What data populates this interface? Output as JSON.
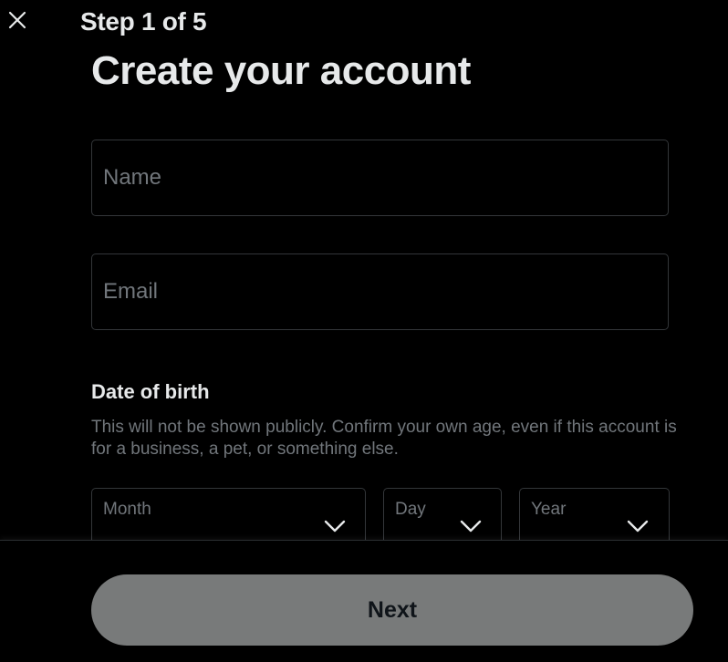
{
  "header": {
    "close_icon": "close-icon",
    "step_label": "Step 1 of 5"
  },
  "main": {
    "title": "Create your account",
    "name_field": {
      "placeholder": "Name",
      "value": ""
    },
    "email_field": {
      "placeholder": "Email",
      "value": ""
    },
    "dob": {
      "heading": "Date of birth",
      "description": "This will not be shown publicly. Confirm your own age, even if this account is for a business, a pet, or something else.",
      "month_label": "Month",
      "day_label": "Day",
      "year_label": "Year"
    }
  },
  "footer": {
    "next_label": "Next"
  },
  "colors": {
    "background": "#000000",
    "text": "#e7e9ea",
    "muted": "#71767b",
    "border": "#333639",
    "next_button": "#787a7a"
  }
}
